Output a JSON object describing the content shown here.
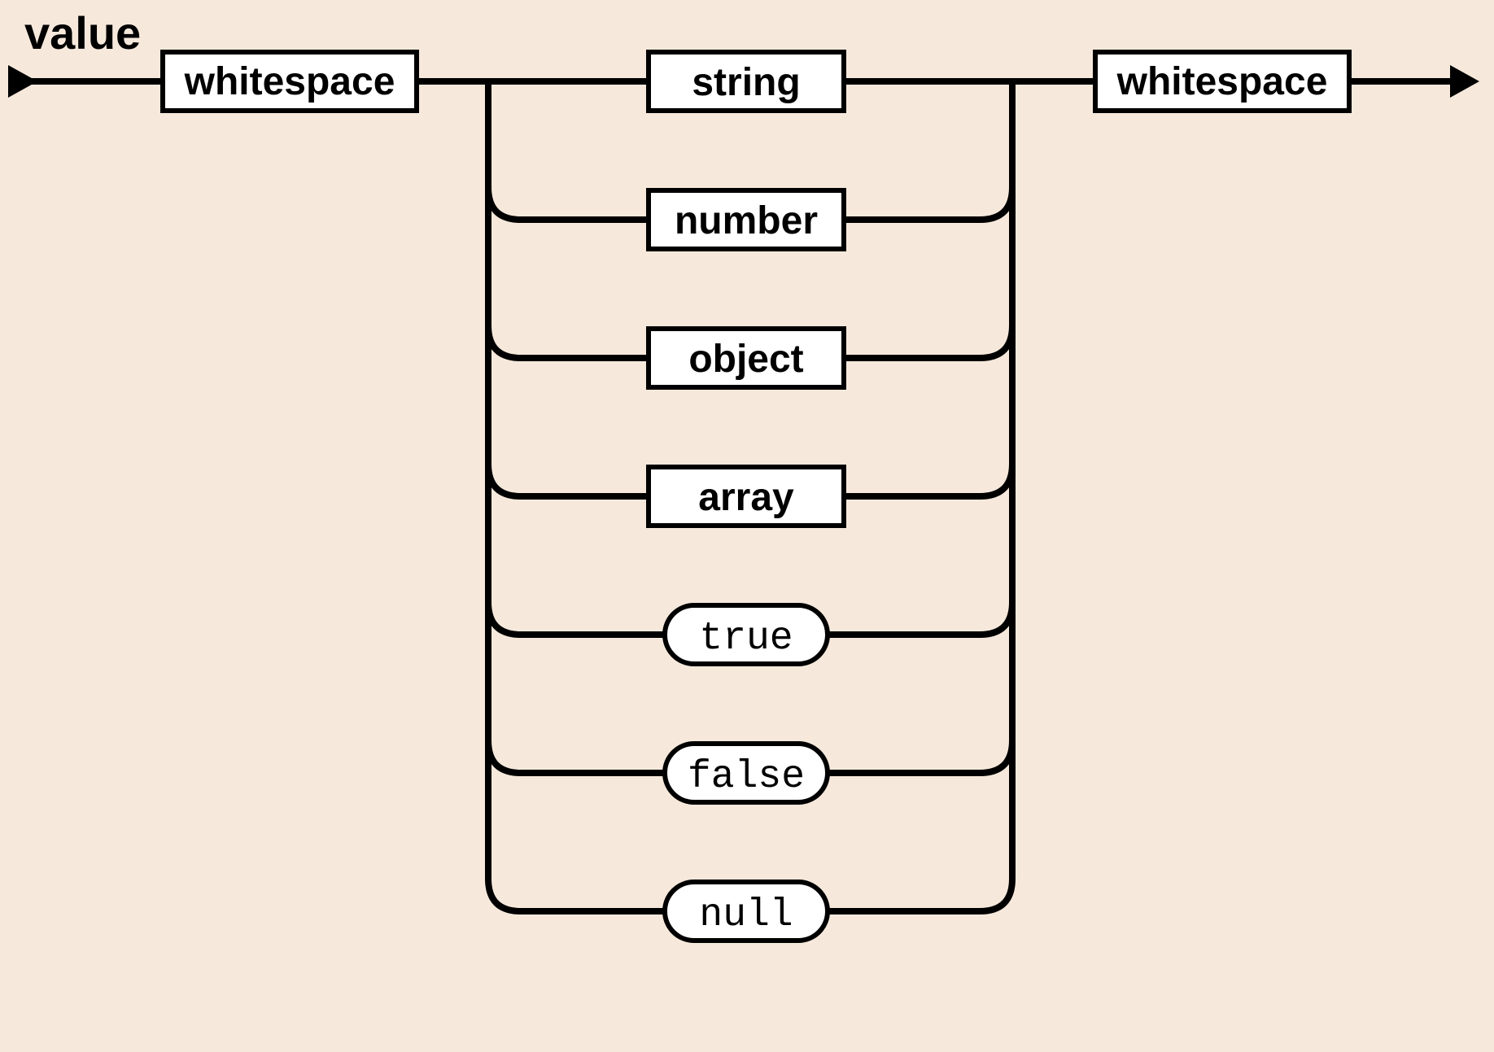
{
  "title": "value",
  "leading": {
    "label": "whitespace"
  },
  "trailing": {
    "label": "whitespace"
  },
  "alternatives": [
    {
      "label": "string",
      "kind": "nonterminal"
    },
    {
      "label": "number",
      "kind": "nonterminal"
    },
    {
      "label": "object",
      "kind": "nonterminal"
    },
    {
      "label": "array",
      "kind": "nonterminal"
    },
    {
      "label": "true",
      "kind": "terminal"
    },
    {
      "label": "false",
      "kind": "terminal"
    },
    {
      "label": "null",
      "kind": "terminal"
    }
  ]
}
